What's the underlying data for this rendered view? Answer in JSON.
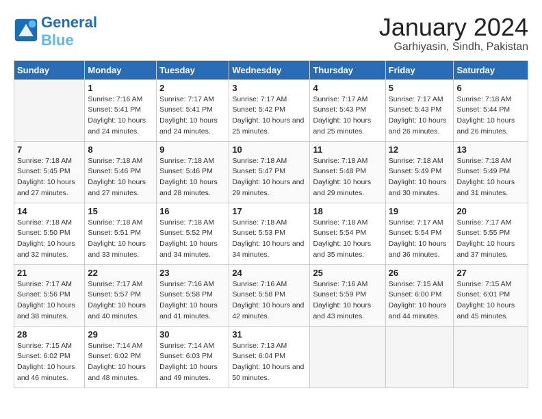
{
  "header": {
    "logo_line1": "General",
    "logo_line2": "Blue",
    "title": "January 2024",
    "subtitle": "Garhiyasin, Sindh, Pakistan"
  },
  "weekdays": [
    "Sunday",
    "Monday",
    "Tuesday",
    "Wednesday",
    "Thursday",
    "Friday",
    "Saturday"
  ],
  "weeks": [
    [
      {
        "day": "",
        "sunrise": "",
        "sunset": "",
        "daylight": ""
      },
      {
        "day": "1",
        "sunrise": "Sunrise: 7:16 AM",
        "sunset": "Sunset: 5:41 PM",
        "daylight": "Daylight: 10 hours and 24 minutes."
      },
      {
        "day": "2",
        "sunrise": "Sunrise: 7:17 AM",
        "sunset": "Sunset: 5:41 PM",
        "daylight": "Daylight: 10 hours and 24 minutes."
      },
      {
        "day": "3",
        "sunrise": "Sunrise: 7:17 AM",
        "sunset": "Sunset: 5:42 PM",
        "daylight": "Daylight: 10 hours and 25 minutes."
      },
      {
        "day": "4",
        "sunrise": "Sunrise: 7:17 AM",
        "sunset": "Sunset: 5:43 PM",
        "daylight": "Daylight: 10 hours and 25 minutes."
      },
      {
        "day": "5",
        "sunrise": "Sunrise: 7:17 AM",
        "sunset": "Sunset: 5:43 PM",
        "daylight": "Daylight: 10 hours and 26 minutes."
      },
      {
        "day": "6",
        "sunrise": "Sunrise: 7:18 AM",
        "sunset": "Sunset: 5:44 PM",
        "daylight": "Daylight: 10 hours and 26 minutes."
      }
    ],
    [
      {
        "day": "7",
        "sunrise": "Sunrise: 7:18 AM",
        "sunset": "Sunset: 5:45 PM",
        "daylight": "Daylight: 10 hours and 27 minutes."
      },
      {
        "day": "8",
        "sunrise": "Sunrise: 7:18 AM",
        "sunset": "Sunset: 5:46 PM",
        "daylight": "Daylight: 10 hours and 27 minutes."
      },
      {
        "day": "9",
        "sunrise": "Sunrise: 7:18 AM",
        "sunset": "Sunset: 5:46 PM",
        "daylight": "Daylight: 10 hours and 28 minutes."
      },
      {
        "day": "10",
        "sunrise": "Sunrise: 7:18 AM",
        "sunset": "Sunset: 5:47 PM",
        "daylight": "Daylight: 10 hours and 29 minutes."
      },
      {
        "day": "11",
        "sunrise": "Sunrise: 7:18 AM",
        "sunset": "Sunset: 5:48 PM",
        "daylight": "Daylight: 10 hours and 29 minutes."
      },
      {
        "day": "12",
        "sunrise": "Sunrise: 7:18 AM",
        "sunset": "Sunset: 5:49 PM",
        "daylight": "Daylight: 10 hours and 30 minutes."
      },
      {
        "day": "13",
        "sunrise": "Sunrise: 7:18 AM",
        "sunset": "Sunset: 5:49 PM",
        "daylight": "Daylight: 10 hours and 31 minutes."
      }
    ],
    [
      {
        "day": "14",
        "sunrise": "Sunrise: 7:18 AM",
        "sunset": "Sunset: 5:50 PM",
        "daylight": "Daylight: 10 hours and 32 minutes."
      },
      {
        "day": "15",
        "sunrise": "Sunrise: 7:18 AM",
        "sunset": "Sunset: 5:51 PM",
        "daylight": "Daylight: 10 hours and 33 minutes."
      },
      {
        "day": "16",
        "sunrise": "Sunrise: 7:18 AM",
        "sunset": "Sunset: 5:52 PM",
        "daylight": "Daylight: 10 hours and 34 minutes."
      },
      {
        "day": "17",
        "sunrise": "Sunrise: 7:18 AM",
        "sunset": "Sunset: 5:53 PM",
        "daylight": "Daylight: 10 hours and 34 minutes."
      },
      {
        "day": "18",
        "sunrise": "Sunrise: 7:18 AM",
        "sunset": "Sunset: 5:54 PM",
        "daylight": "Daylight: 10 hours and 35 minutes."
      },
      {
        "day": "19",
        "sunrise": "Sunrise: 7:17 AM",
        "sunset": "Sunset: 5:54 PM",
        "daylight": "Daylight: 10 hours and 36 minutes."
      },
      {
        "day": "20",
        "sunrise": "Sunrise: 7:17 AM",
        "sunset": "Sunset: 5:55 PM",
        "daylight": "Daylight: 10 hours and 37 minutes."
      }
    ],
    [
      {
        "day": "21",
        "sunrise": "Sunrise: 7:17 AM",
        "sunset": "Sunset: 5:56 PM",
        "daylight": "Daylight: 10 hours and 38 minutes."
      },
      {
        "day": "22",
        "sunrise": "Sunrise: 7:17 AM",
        "sunset": "Sunset: 5:57 PM",
        "daylight": "Daylight: 10 hours and 40 minutes."
      },
      {
        "day": "23",
        "sunrise": "Sunrise: 7:16 AM",
        "sunset": "Sunset: 5:58 PM",
        "daylight": "Daylight: 10 hours and 41 minutes."
      },
      {
        "day": "24",
        "sunrise": "Sunrise: 7:16 AM",
        "sunset": "Sunset: 5:58 PM",
        "daylight": "Daylight: 10 hours and 42 minutes."
      },
      {
        "day": "25",
        "sunrise": "Sunrise: 7:16 AM",
        "sunset": "Sunset: 5:59 PM",
        "daylight": "Daylight: 10 hours and 43 minutes."
      },
      {
        "day": "26",
        "sunrise": "Sunrise: 7:15 AM",
        "sunset": "Sunset: 6:00 PM",
        "daylight": "Daylight: 10 hours and 44 minutes."
      },
      {
        "day": "27",
        "sunrise": "Sunrise: 7:15 AM",
        "sunset": "Sunset: 6:01 PM",
        "daylight": "Daylight: 10 hours and 45 minutes."
      }
    ],
    [
      {
        "day": "28",
        "sunrise": "Sunrise: 7:15 AM",
        "sunset": "Sunset: 6:02 PM",
        "daylight": "Daylight: 10 hours and 46 minutes."
      },
      {
        "day": "29",
        "sunrise": "Sunrise: 7:14 AM",
        "sunset": "Sunset: 6:02 PM",
        "daylight": "Daylight: 10 hours and 48 minutes."
      },
      {
        "day": "30",
        "sunrise": "Sunrise: 7:14 AM",
        "sunset": "Sunset: 6:03 PM",
        "daylight": "Daylight: 10 hours and 49 minutes."
      },
      {
        "day": "31",
        "sunrise": "Sunrise: 7:13 AM",
        "sunset": "Sunset: 6:04 PM",
        "daylight": "Daylight: 10 hours and 50 minutes."
      },
      {
        "day": "",
        "sunrise": "",
        "sunset": "",
        "daylight": ""
      },
      {
        "day": "",
        "sunrise": "",
        "sunset": "",
        "daylight": ""
      },
      {
        "day": "",
        "sunrise": "",
        "sunset": "",
        "daylight": ""
      }
    ]
  ]
}
